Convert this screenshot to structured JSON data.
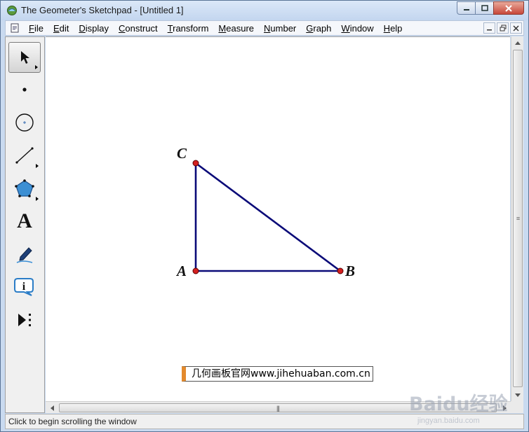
{
  "window": {
    "title": "The Geometer's Sketchpad - [Untitled 1]"
  },
  "menu": [
    {
      "label": "File",
      "mnemonic": "F",
      "rest": "ile"
    },
    {
      "label": "Edit",
      "mnemonic": "E",
      "rest": "dit"
    },
    {
      "label": "Display",
      "mnemonic": "D",
      "rest": "isplay"
    },
    {
      "label": "Construct",
      "mnemonic": "C",
      "rest": "onstruct"
    },
    {
      "label": "Transform",
      "mnemonic": "T",
      "rest": "ransform"
    },
    {
      "label": "Measure",
      "mnemonic": "M",
      "rest": "easure"
    },
    {
      "label": "Number",
      "mnemonic": "N",
      "rest": "umber"
    },
    {
      "label": "Graph",
      "mnemonic": "G",
      "rest": "raph"
    },
    {
      "label": "Window",
      "mnemonic": "W",
      "rest": "indow"
    },
    {
      "label": "Help",
      "mnemonic": "H",
      "rest": "elp"
    }
  ],
  "toolbox": {
    "tools": [
      {
        "name": "selection-arrow-tool",
        "icon": "arrow-icon",
        "active": true
      },
      {
        "name": "point-tool",
        "icon": "point-icon"
      },
      {
        "name": "compass-tool",
        "icon": "circle-icon"
      },
      {
        "name": "straightedge-tool",
        "icon": "segment-icon"
      },
      {
        "name": "polygon-tool",
        "icon": "polygon-icon"
      },
      {
        "name": "text-tool",
        "icon": "text-icon",
        "glyph": "A"
      },
      {
        "name": "marker-tool",
        "icon": "marker-icon"
      },
      {
        "name": "information-tool",
        "icon": "info-icon",
        "glyph": "i"
      },
      {
        "name": "custom-tool",
        "icon": "custom-tool-icon"
      }
    ]
  },
  "sketch": {
    "points": [
      {
        "label": "A"
      },
      {
        "label": "B"
      },
      {
        "label": "C"
      }
    ],
    "segment_color": "#0a0a78",
    "point_color": "#d42020",
    "caption": "几何画板官网www.jihehuaban.com.cn"
  },
  "status": {
    "text": "Click to begin scrolling the window"
  },
  "watermark": {
    "brand": "Baidu经验",
    "url": "jingyan.baidu.com"
  }
}
